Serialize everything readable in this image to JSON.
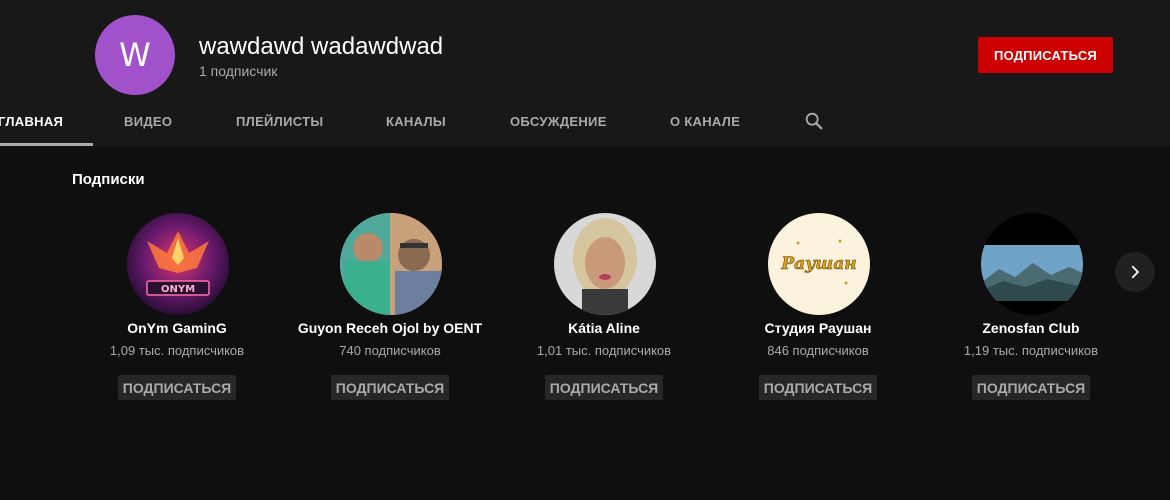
{
  "channel": {
    "avatar_letter": "W",
    "avatar_color": "#a151c9",
    "name": "wawdawd wadawdwad",
    "subscribers": "1 подписчик",
    "subscribe_label": "ПОДПИСАТЬСЯ"
  },
  "tabs": [
    {
      "label": "ГЛАВНАЯ",
      "active": true
    },
    {
      "label": "ВИДЕО"
    },
    {
      "label": "ПЛЕЙЛИСТЫ"
    },
    {
      "label": "КАНАЛЫ"
    },
    {
      "label": "ОБСУЖДЕНИЕ"
    },
    {
      "label": "О КАНАЛЕ"
    }
  ],
  "search_icon": "search-icon",
  "section": {
    "title": "Подписки"
  },
  "channels": [
    {
      "name": "OnYm GaminG",
      "subscribers": "1,09 тыс. подписчиков",
      "subscribe_label": "ПОДПИСАТЬСЯ",
      "avatar_text": "ONYM"
    },
    {
      "name": "Guyon Receh Ojol by OENT",
      "subscribers": "740 подписчиков",
      "subscribe_label": "ПОДПИСАТЬСЯ"
    },
    {
      "name": "Kátia Aline",
      "subscribers": "1,01 тыс. подписчиков",
      "subscribe_label": "ПОДПИСАТЬСЯ"
    },
    {
      "name": "Студия Раушан",
      "subscribers": "846 подписчиков",
      "subscribe_label": "ПОДПИСАТЬСЯ",
      "avatar_text": "Раушан"
    },
    {
      "name": "Zenosfan Club",
      "subscribers": "1,19 тыс. подписчиков",
      "subscribe_label": "ПОДПИСАТЬСЯ"
    }
  ],
  "next_icon": "chevron-right-icon",
  "colors": {
    "background": "#0f0f0f",
    "header": "#181818",
    "subscribe_red": "#cc0000",
    "muted_text": "#aaaaaa"
  }
}
